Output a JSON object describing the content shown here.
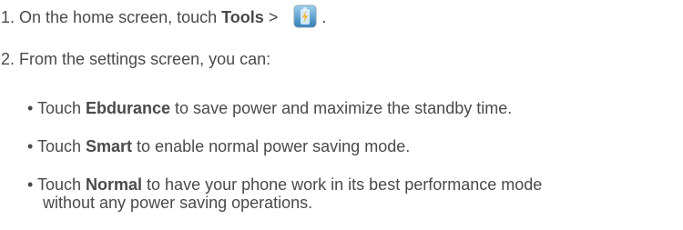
{
  "step1": {
    "prefix": "1. On the home screen, touch ",
    "bold": "Tools",
    "suffix": " > ",
    "icon": "battery-manager-icon",
    "end": " ."
  },
  "step2": {
    "text": "2. From the settings screen, you can:"
  },
  "bullets": [
    {
      "prefix": "• Touch ",
      "bold": "Ebdurance",
      "suffix": " to save power and maximize the standby time."
    },
    {
      "prefix": "• Touch ",
      "bold": "Smart",
      "suffix": " to enable normal power saving mode."
    },
    {
      "prefix": "• Touch ",
      "bold": "Normal",
      "suffix": " to have your phone work in its best performance mode",
      "continuation": "without any power saving operations."
    }
  ],
  "colors": {
    "text": "#4a4a4a",
    "icon_blue": "#3f8fc4",
    "icon_bolt": "#f0b429"
  }
}
